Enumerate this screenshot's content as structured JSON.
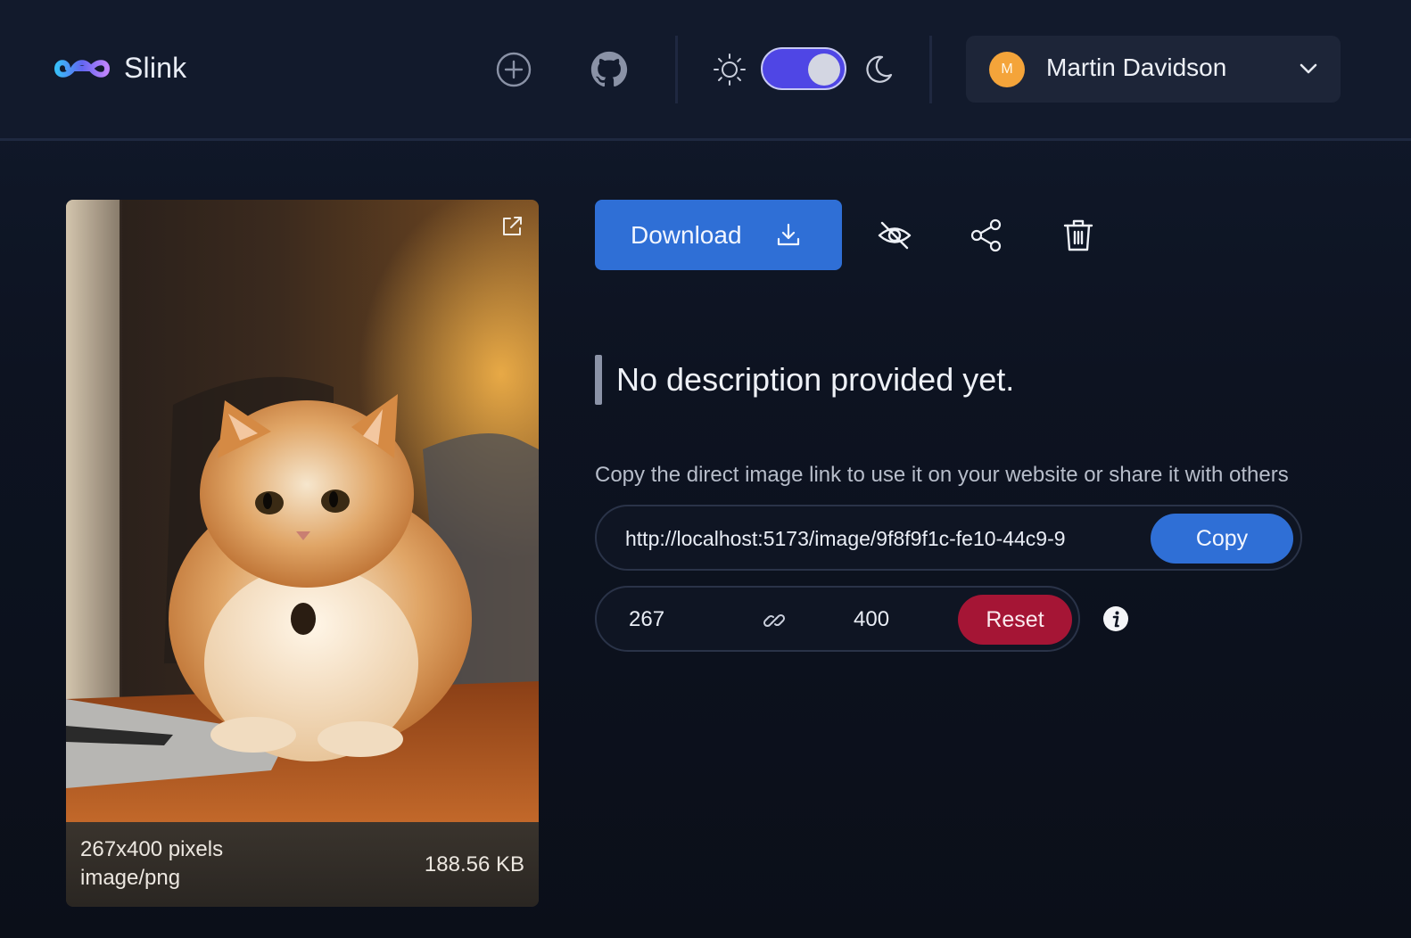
{
  "app": {
    "brand": "Slink",
    "logo_icon": "infinity-logo-icon"
  },
  "header": {
    "icons": [
      "plus-circle-icon",
      "github-icon",
      "sun-icon",
      "moon-icon"
    ],
    "theme_toggle": {
      "state": "dark"
    },
    "user": {
      "initial": "M",
      "name": "Martin Davidson",
      "avatar_color": "#f4a43a"
    }
  },
  "image": {
    "dimensions": "267x400 pixels",
    "mime": "image/png",
    "size": "188.56 KB"
  },
  "actions": {
    "download_label": "Download",
    "icons": [
      "download-icon",
      "eye-off-icon",
      "share-icon",
      "trash-icon"
    ]
  },
  "description": "No description provided yet.",
  "link": {
    "hint": "Copy the direct image link to use it on your website or share it with others",
    "url": "http://localhost:5173/image/9f8f9f1c-fe10-44c9-9",
    "copy_label": "Copy"
  },
  "resize": {
    "width": "267",
    "height": "400",
    "reset_label": "Reset"
  },
  "colors": {
    "accent": "#2f6fd6",
    "toggle": "#4f46e5",
    "danger": "#a51535"
  }
}
